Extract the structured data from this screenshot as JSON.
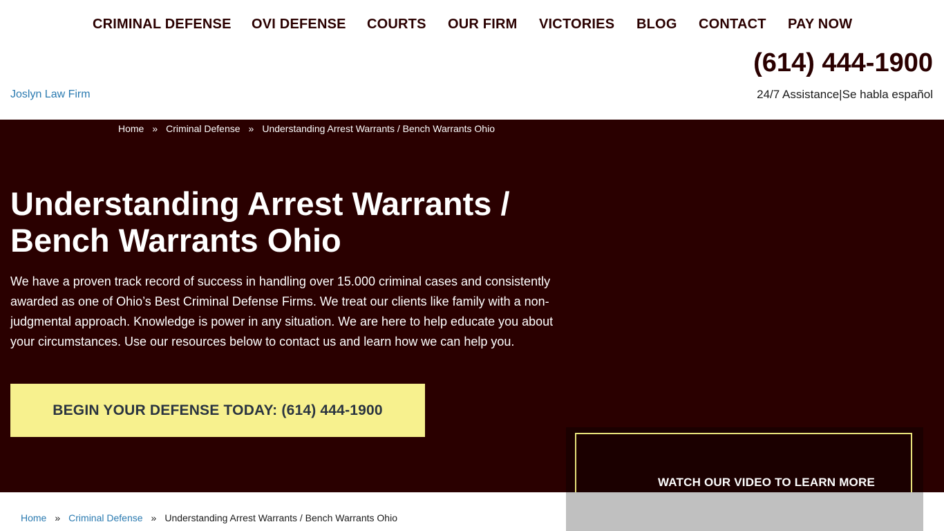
{
  "nav": {
    "items": [
      {
        "label": "CRIMINAL DEFENSE"
      },
      {
        "label": "OVI DEFENSE"
      },
      {
        "label": "COURTS"
      },
      {
        "label": "OUR FIRM"
      },
      {
        "label": "VICTORIES"
      },
      {
        "label": "BLOG"
      },
      {
        "label": "CONTACT"
      },
      {
        "label": "PAY NOW"
      }
    ]
  },
  "header": {
    "logo_alt": "Joslyn Law Firm",
    "phone": "(614) 444-1900",
    "assistance": "24/7 Assistance|Se habla español"
  },
  "breadcrumb": {
    "home": "Home",
    "separator": "»",
    "section": "Criminal Defense",
    "current": "Understanding Arrest Warrants / Bench Warrants Ohio"
  },
  "hero": {
    "title": "Understanding Arrest Warrants / Bench Warrants Ohio",
    "description": "We have a proven track record of success in handling over 15.000 criminal cases and consistently awarded as one of Ohio’s Best Criminal Defense Firms. We treat our clients like family with a non-judgmental approach. Knowledge is power in any situation. We are here to help educate you about your circumstances. Use our resources below to contact us and learn how we can help you.",
    "cta_label": "BEGIN YOUR DEFENSE TODAY: (614) 444-1900"
  },
  "video": {
    "label": "WATCH OUR VIDEO TO LEARN MORE"
  },
  "colors": {
    "brand_dark": "#2a0000",
    "cta_yellow": "#f7f18e",
    "link_blue": "#2a7ab0",
    "frame_yellow": "#e8e27a"
  }
}
